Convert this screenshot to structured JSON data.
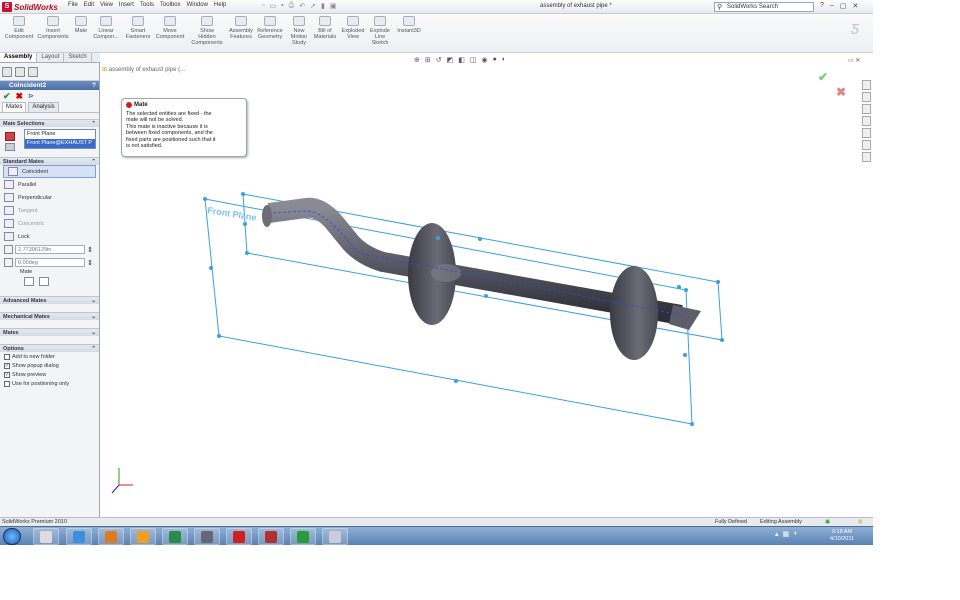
{
  "app": {
    "name": "SolidWorks",
    "menu": [
      "File",
      "Edit",
      "View",
      "Insert",
      "Tools",
      "Toolbox",
      "Window",
      "Help"
    ],
    "document_title": "assembly of exhaust pipe *",
    "search_placeholder": "SolidWorks Search"
  },
  "ribbon": {
    "items": [
      {
        "label": "Edit\nComponent"
      },
      {
        "label": "Insert\nComponents"
      },
      {
        "label": "Mate"
      },
      {
        "label": "Linear\nCompon..."
      },
      {
        "label": "Smart\nFasteners"
      },
      {
        "label": "Move\nComponent"
      },
      {
        "label": "Show\nHidden\nComponents"
      },
      {
        "label": "Assembly\nFeatures"
      },
      {
        "label": "Reference\nGeometry"
      },
      {
        "label": "New\nMotion\nStudy"
      },
      {
        "label": "Bill of\nMaterials"
      },
      {
        "label": "Exploded\nView"
      },
      {
        "label": "Explode\nLine\nSketch"
      },
      {
        "label": "Instant3D"
      }
    ]
  },
  "cm_tabs": [
    "Assembly",
    "Layout",
    "Sketch"
  ],
  "property_manager": {
    "title": "Coincident2",
    "subtabs": [
      "Mates",
      "Analysis"
    ],
    "mate_selections_header": "Mate Selections",
    "selections": [
      "Front Plane",
      "Front Plane@EXHAUST P"
    ],
    "standard_mates_header": "Standard Mates",
    "mates": [
      "Coincident",
      "Parallel",
      "Perpendicular",
      "Tangent",
      "Concentric",
      "Lock"
    ],
    "distance_value": "2.77306129in",
    "angle_value": "0.00deg",
    "mate_alignment_label": "Mate",
    "advanced_mates": "Advanced Mates",
    "mechanical_mates": "Mechanical Mates",
    "mates_section": "Mates",
    "options_header": "Options",
    "options": [
      {
        "label": "Add to new folder",
        "checked": false
      },
      {
        "label": "Show popup dialog",
        "checked": true
      },
      {
        "label": "Show preview",
        "checked": true
      },
      {
        "label": "Use for positioning only",
        "checked": false
      }
    ]
  },
  "tree_root": "assembly of exhaust pipe (...",
  "tooltip": {
    "title": "Mate",
    "body": "The selected entities are fixed - the\nmate will not be solved.\nThis mate is inactive because it is\nbetween fixed components, and the\nfixed parts are positioned such that it\nis not satisfied."
  },
  "viewport": {
    "plane_label": "Front Plane",
    "accent": "#3aa0e0"
  },
  "status": {
    "product": "SolidWorks Premium 2010",
    "state": "Fully Defined",
    "mode": "Editing Assembly"
  },
  "clock": {
    "time": "9:18 AM",
    "date": "4/10/2011"
  }
}
